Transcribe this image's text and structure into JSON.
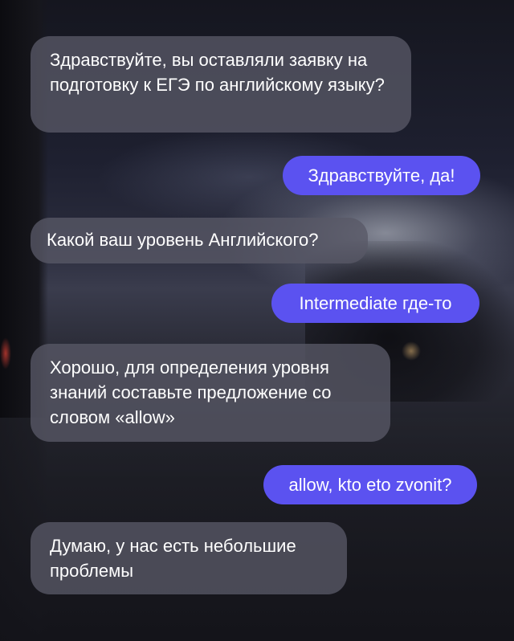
{
  "messages": [
    {
      "side": "incoming",
      "text": "Здравствуйте, вы оставляли заявку на подготовку к ЕГЭ по английскому языку?"
    },
    {
      "side": "outgoing",
      "text": "Здравствуйте, да!"
    },
    {
      "side": "incoming",
      "text": "Какой ваш уровень Английского?"
    },
    {
      "side": "outgoing",
      "text": "Intermediate где-то"
    },
    {
      "side": "incoming",
      "text": "Хорошо, для определения уровня знаний составьте предложение со словом «allow»"
    },
    {
      "side": "outgoing",
      "text": "allow, kto eto zvonit?"
    },
    {
      "side": "incoming",
      "text": "Думаю, у нас есть небольшие проблемы"
    }
  ],
  "colors": {
    "incoming_bubble": "#585866",
    "outgoing_bubble": "#5b52f0",
    "text": "#ffffff"
  }
}
